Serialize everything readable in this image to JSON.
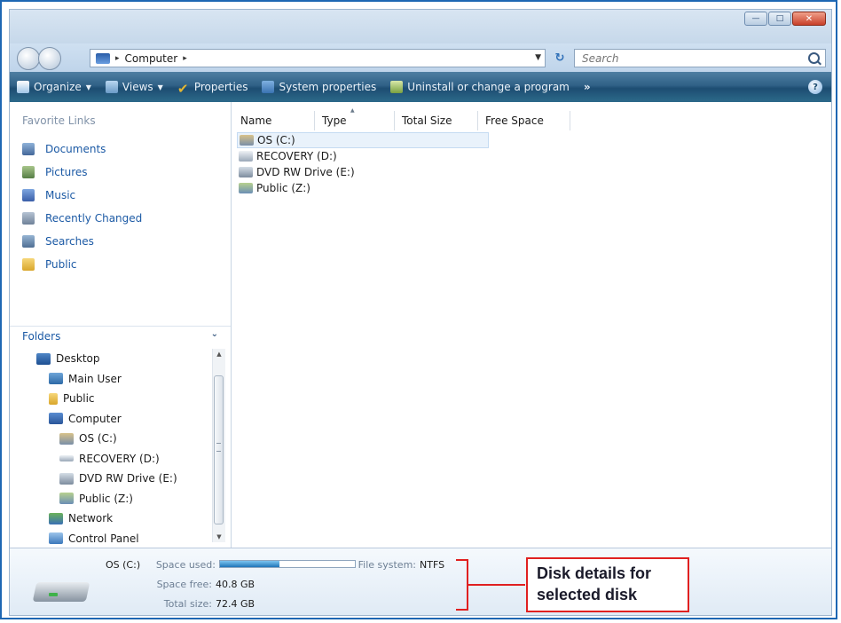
{
  "address": {
    "location": "Computer",
    "sep1": "▸",
    "sep2": "▸"
  },
  "search": {
    "placeholder": "Search"
  },
  "toolbar": {
    "organize": "Organize",
    "views": "Views",
    "properties": "Properties",
    "system_properties": "System properties",
    "uninstall": "Uninstall or change a program",
    "more": "»",
    "help": "?"
  },
  "favorites": {
    "heading": "Favorite Links",
    "items": [
      {
        "label": "Documents",
        "icon": "documents-icon"
      },
      {
        "label": "Pictures",
        "icon": "pictures-icon"
      },
      {
        "label": "Music",
        "icon": "music-icon"
      },
      {
        "label": "Recently Changed",
        "icon": "recently-changed-icon"
      },
      {
        "label": "Searches",
        "icon": "searches-icon"
      },
      {
        "label": "Public",
        "icon": "public-folder-icon"
      }
    ]
  },
  "folders": {
    "heading": "Folders",
    "tree": [
      {
        "label": "Desktop",
        "level": 0,
        "icon": "desktop-icon"
      },
      {
        "label": "Main User",
        "level": 1,
        "icon": "user-folder-icon"
      },
      {
        "label": "Public",
        "level": 1,
        "icon": "public-folder-icon"
      },
      {
        "label": "Computer",
        "level": 1,
        "icon": "computer-icon"
      },
      {
        "label": "OS (C:)",
        "level": 2,
        "icon": "local-disk-icon"
      },
      {
        "label": "RECOVERY (D:)",
        "level": 2,
        "icon": "hard-drive-icon"
      },
      {
        "label": "DVD RW Drive (E:)",
        "level": 2,
        "icon": "dvd-drive-icon"
      },
      {
        "label": "Public (Z:)",
        "level": 2,
        "icon": "network-drive-icon"
      },
      {
        "label": "Network",
        "level": 1,
        "icon": "network-icon"
      },
      {
        "label": "Control Panel",
        "level": 1,
        "icon": "control-panel-icon"
      }
    ]
  },
  "columns": {
    "name": "Name",
    "type": "Type",
    "total_size": "Total Size",
    "free_space": "Free Space"
  },
  "drives": [
    {
      "name": "OS (C:)",
      "selected": true,
      "icon": "local-disk-icon"
    },
    {
      "name": "RECOVERY (D:)",
      "selected": false,
      "icon": "hard-drive-icon"
    },
    {
      "name": "DVD RW Drive (E:)",
      "selected": false,
      "icon": "dvd-drive-icon"
    },
    {
      "name": "Public (Z:)",
      "selected": false,
      "icon": "network-drive-icon"
    }
  ],
  "details": {
    "name": "OS (C:)",
    "space_used_label": "Space used:",
    "space_used_fraction": 0.44,
    "file_system_label": "File system:",
    "file_system": "NTFS",
    "space_free_label": "Space free:",
    "space_free": "40.8 GB",
    "total_size_label": "Total size:",
    "total_size": "72.4 GB"
  },
  "callout": {
    "line1": "Disk details for",
    "line2": "selected disk"
  },
  "colors": {
    "accent": "#e02020",
    "link": "#1c5aa5",
    "command_bar": "#2f6086"
  }
}
